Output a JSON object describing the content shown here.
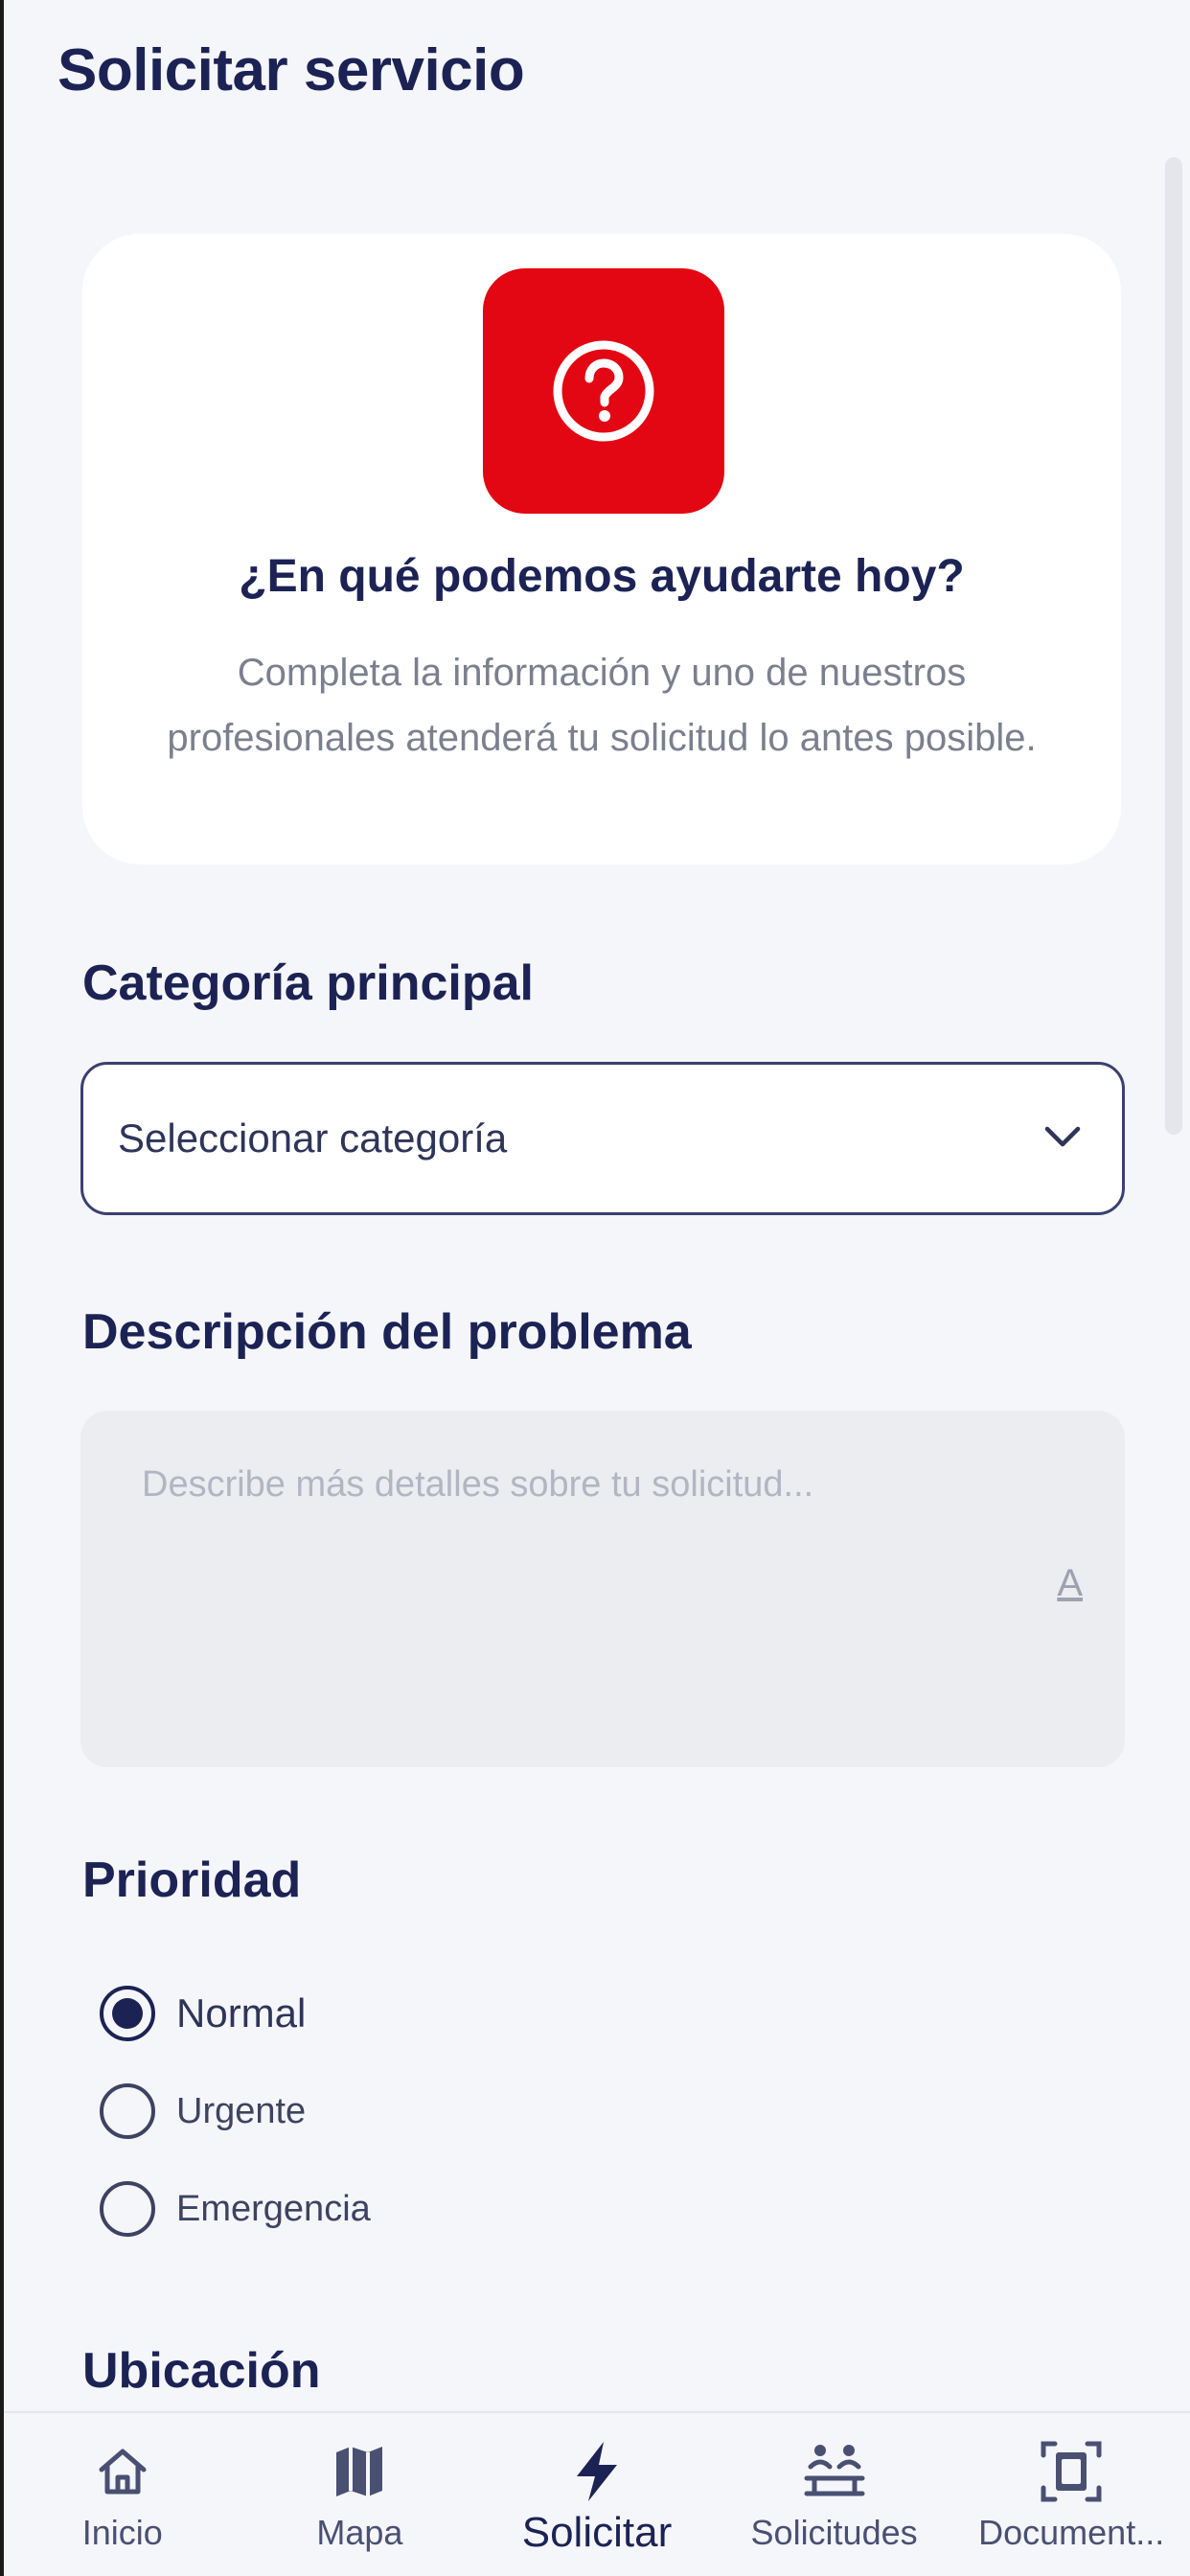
{
  "header": {
    "title": "Solicitar servicio"
  },
  "hero": {
    "icon": "question-circle-icon",
    "heading": "¿En qué podemos ayudarte hoy?",
    "description": "Completa la información y uno de nuestros profesionales atenderá tu solicitud lo antes posible."
  },
  "category": {
    "label": "Categoría principal",
    "value": "Seleccionar categoría",
    "icon": "chevron-down-icon"
  },
  "description_field": {
    "label": "Descripción del problema",
    "placeholder": "Describe más detalles sobre tu solicitud...",
    "icon": "text-format-icon",
    "icon_glyph": "A"
  },
  "priority": {
    "label": "Prioridad",
    "options": [
      {
        "label": "Normal",
        "selected": true
      },
      {
        "label": "Urgente",
        "selected": false
      },
      {
        "label": "Emergencia",
        "selected": false
      }
    ]
  },
  "location": {
    "label": "Ubicación"
  },
  "bottom_nav": {
    "items": [
      {
        "label": "Inicio",
        "icon": "home-icon",
        "active": false
      },
      {
        "label": "Mapa",
        "icon": "map-icon",
        "active": false
      },
      {
        "label": "Solicitar",
        "icon": "lightning-icon",
        "active": true
      },
      {
        "label": "Solicitudes",
        "icon": "people-queue-icon",
        "active": false
      },
      {
        "label": "Document...",
        "icon": "document-scan-icon",
        "active": false
      }
    ]
  },
  "colors": {
    "primary": "#1c2354",
    "accent_red": "#e30613",
    "background": "#f5f6fa"
  }
}
